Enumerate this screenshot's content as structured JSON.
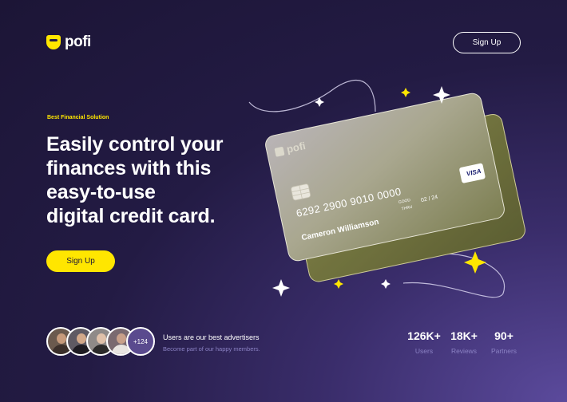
{
  "header": {
    "logo_text": "pofi",
    "signup_label": "Sign Up"
  },
  "hero": {
    "eyebrow": "Best Financial Solution",
    "headline_lines": [
      "Easily control your",
      "finances with this",
      "easy-to-use",
      "digital credit card."
    ],
    "cta_label": "Sign Up"
  },
  "card": {
    "brand": "pofi",
    "number": "6292 2900 9010 0000",
    "holder": "Cameron Williamson",
    "good_label": "GOOD",
    "thru_label": "THRU",
    "expiry": "02 / 24",
    "network": "VISA"
  },
  "social": {
    "more_count": "+124",
    "title": "Users are our best advertisers",
    "subtitle": "Become part of our happy members."
  },
  "stats": [
    {
      "value": "126K+",
      "label": "Users"
    },
    {
      "value": "18K+",
      "label": "Reviews"
    },
    {
      "value": "90+",
      "label": "Partners"
    }
  ],
  "colors": {
    "accent": "#ffe600",
    "background": "#231b44",
    "muted_text": "#8b82c4"
  },
  "icons": {
    "sparkles": "four-point-star-icon",
    "chip": "card-chip-icon"
  }
}
